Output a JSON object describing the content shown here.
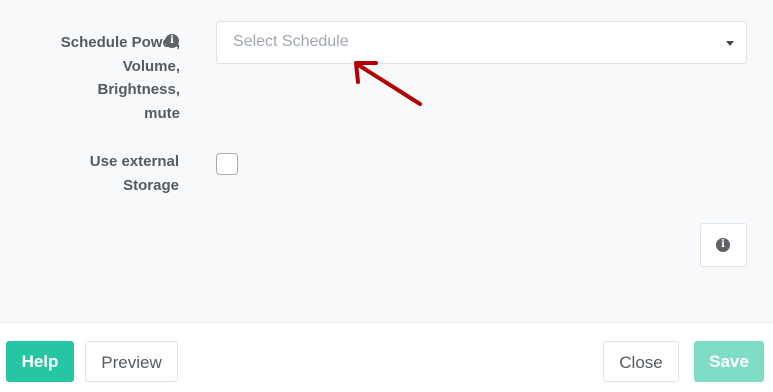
{
  "form": {
    "schedule_label_lines": [
      "Schedule Power,",
      "Volume,",
      "Brightness,",
      "mute"
    ],
    "schedule_select": {
      "placeholder": "Select Schedule",
      "icon": "chevron-down-icon"
    },
    "storage_label_lines": [
      "Use external",
      "Storage"
    ],
    "storage_checkbox": {
      "checked": false
    },
    "info_icon": "info-icon"
  },
  "annotation": {
    "type": "arrow",
    "color": "#b00000",
    "points_to": "schedule-select"
  },
  "footer": {
    "help_label": "Help",
    "preview_label": "Preview",
    "close_label": "Close",
    "save_label": "Save"
  },
  "colors": {
    "accent": "#26c6a2",
    "accent_disabled": "#7fddc6",
    "annotation": "#b00000"
  }
}
